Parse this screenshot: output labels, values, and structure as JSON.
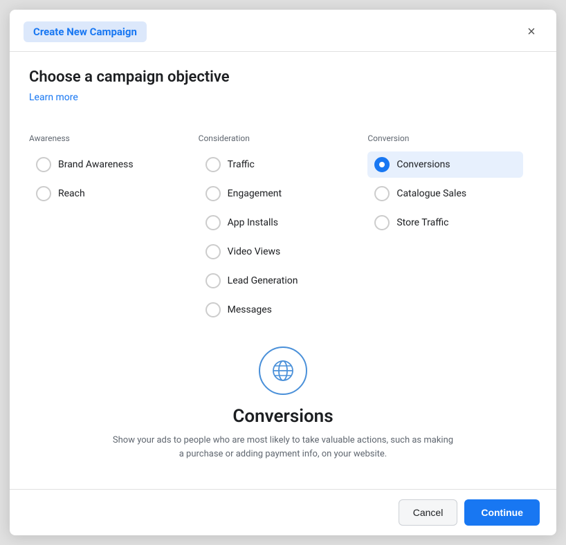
{
  "modal": {
    "title": "Create New Campaign",
    "close_label": "×",
    "section_heading": "Choose a campaign objective",
    "learn_more": "Learn more"
  },
  "columns": [
    {
      "label": "Awareness",
      "options": [
        {
          "id": "brand-awareness",
          "text": "Brand Awareness",
          "selected": false
        },
        {
          "id": "reach",
          "text": "Reach",
          "selected": false
        }
      ]
    },
    {
      "label": "Consideration",
      "options": [
        {
          "id": "traffic",
          "text": "Traffic",
          "selected": false
        },
        {
          "id": "engagement",
          "text": "Engagement",
          "selected": false
        },
        {
          "id": "app-installs",
          "text": "App Installs",
          "selected": false
        },
        {
          "id": "video-views",
          "text": "Video Views",
          "selected": false
        },
        {
          "id": "lead-generation",
          "text": "Lead Generation",
          "selected": false
        },
        {
          "id": "messages",
          "text": "Messages",
          "selected": false
        }
      ]
    },
    {
      "label": "Conversion",
      "options": [
        {
          "id": "conversions",
          "text": "Conversions",
          "selected": true
        },
        {
          "id": "catalogue-sales",
          "text": "Catalogue Sales",
          "selected": false
        },
        {
          "id": "store-traffic",
          "text": "Store Traffic",
          "selected": false
        }
      ]
    }
  ],
  "preview": {
    "title": "Conversions",
    "description": "Show your ads to people who are most likely to take valuable actions, such as making a purchase or adding payment info, on your website."
  },
  "footer": {
    "cancel_label": "Cancel",
    "continue_label": "Continue"
  },
  "colors": {
    "selected_bg": "#e7f0fd",
    "selected_radio": "#1877f2",
    "link": "#1877f2",
    "globe": "#4a90d9"
  }
}
